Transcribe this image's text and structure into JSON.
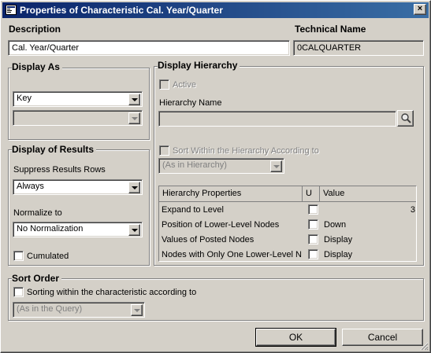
{
  "window": {
    "title": "Properties of Characteristic Cal. Year/Quarter",
    "close_label": "×"
  },
  "description": {
    "label": "Description",
    "value": "Cal. Year/Quarter"
  },
  "technical_name": {
    "label": "Technical Name",
    "value": "0CALQUARTER"
  },
  "display_as": {
    "title": "Display As",
    "selected": "Key",
    "secondary_selected": ""
  },
  "display_of_results": {
    "title": "Display of Results",
    "suppress_label": "Suppress Results Rows",
    "suppress_value": "Always",
    "normalize_label": "Normalize to",
    "normalize_value": "No Normalization",
    "cumulated_label": "Cumulated"
  },
  "display_hierarchy": {
    "title": "Display Hierarchy",
    "active_label": "Active",
    "hierarchy_name_label": "Hierarchy Name",
    "hierarchy_name_value": "",
    "sort_label": "Sort Within the Hierarchy According to",
    "sort_value": "(As in Hierarchy)",
    "table": {
      "headers": [
        "Hierarchy Properties",
        "U",
        "Value"
      ],
      "rows": [
        {
          "property": "Expand to Level",
          "value": "3"
        },
        {
          "property": "Position of Lower-Level Nodes",
          "value": "Down"
        },
        {
          "property": "Values of Posted Nodes",
          "value": "Display"
        },
        {
          "property": "Nodes with Only One Lower-Level Node",
          "value": "Display"
        }
      ]
    }
  },
  "sort_order": {
    "title": "Sort Order",
    "checkbox_label": "Sorting within the characteristic according to",
    "combo_value": "(As in the Query)"
  },
  "buttons": {
    "ok": "OK",
    "cancel": "Cancel"
  }
}
